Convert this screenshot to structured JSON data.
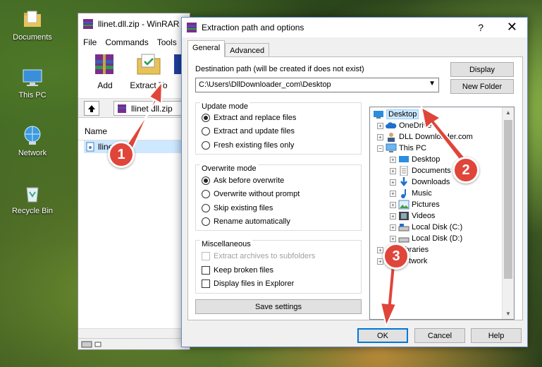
{
  "desktop": {
    "icons": [
      {
        "label": "Documents"
      },
      {
        "label": "This PC"
      },
      {
        "label": "Network"
      },
      {
        "label": "Recycle Bin"
      }
    ]
  },
  "winrar": {
    "title": "llinet.dll.zip - WinRAR",
    "menu": [
      "File",
      "Commands",
      "Tools"
    ],
    "toolbar": [
      "Add",
      "Extract To"
    ],
    "address": "llinet.dll.zip",
    "column_name": "Name",
    "file_name": "llinet"
  },
  "dialog": {
    "title": "Extraction path and options",
    "help": "?",
    "close": "✕",
    "tabs": [
      "General",
      "Advanced"
    ],
    "dest_label": "Destination path (will be created if does not exist)",
    "dest_value": "C:\\Users\\DllDownloader_com\\Desktop",
    "display_button": "Display",
    "new_folder_button": "New Folder",
    "update_mode": {
      "title": "Update mode",
      "options": [
        "Extract and replace files",
        "Extract and update files",
        "Fresh existing files only"
      ],
      "selected": 0
    },
    "overwrite_mode": {
      "title": "Overwrite mode",
      "options": [
        "Ask before overwrite",
        "Overwrite without prompt",
        "Skip existing files",
        "Rename automatically"
      ],
      "selected": 0
    },
    "misc": {
      "title": "Miscellaneous",
      "options": [
        "Extract archives to subfolders",
        "Keep broken files",
        "Display files in Explorer"
      ]
    },
    "save_settings": "Save settings",
    "tree": {
      "desktop": "Desktop",
      "onedrive": "OneDrive",
      "dll": "DLL Downloader.com",
      "thispc": "This PC",
      "children": [
        "Desktop",
        "Documents",
        "Downloads",
        "Music",
        "Pictures",
        "Videos",
        "Local Disk (C:)",
        "Local Disk (D:)"
      ],
      "libraries": "Libraries",
      "network": "Network"
    },
    "ok": "OK",
    "cancel": "Cancel",
    "help_button": "Help"
  },
  "annotations": [
    "1",
    "2",
    "3"
  ],
  "colors": {
    "badge": "#e0453a",
    "arrow": "#e0453a",
    "selection": "#cce8ff"
  }
}
